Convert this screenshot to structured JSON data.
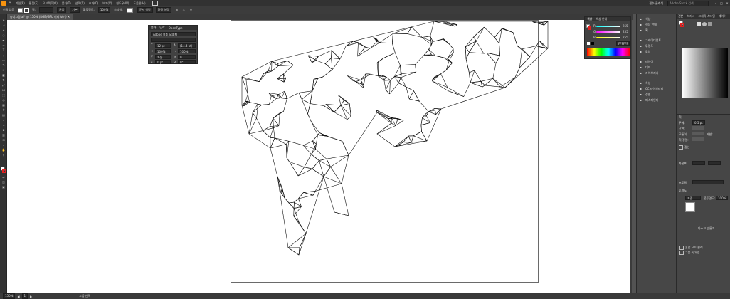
{
  "menu": [
    "파일(F)",
    "편집(E)",
    "오브젝트(O)",
    "문자(T)",
    "선택(S)",
    "효과(C)",
    "보기(V)",
    "윈도우(W)",
    "도움말(H)"
  ],
  "workspace": "필수 클래식",
  "search_placeholder": "Adobe Stock 검색",
  "control": {
    "selection_label": "선택 없음",
    "stroke_label": "획:",
    "stroke_value": "",
    "uniform": "균등",
    "basic": "기본",
    "opacity_label": "불투명도:",
    "opacity_value": "100%",
    "style_label": "스타일:",
    "doc_setup": "문서 설정",
    "prefs": "환경 설정"
  },
  "document_tab": "총기그림.ai* @ 150% (RGB/GPU 미리 보기)",
  "status": {
    "zoom": "150%",
    "page": "1",
    "tool": "그룹 선택"
  },
  "char_panel": {
    "tabs": [
      "문자",
      "단락",
      "OpenType"
    ],
    "font": "Adobe 명조 Std M",
    "font_style": "",
    "size": "12 pt",
    "leading": "(14.4 pt)",
    "kerning": "자동",
    "tracking": "0",
    "scale_v": "100%",
    "scale_h": "100%",
    "baseline": "0 pt",
    "rotate": "0°"
  },
  "color_panel": {
    "tabs": [
      "색상",
      "색상 안내"
    ],
    "channels": [
      {
        "name": "R",
        "value": "255"
      },
      {
        "name": "G",
        "value": "255"
      },
      {
        "name": "B",
        "value": "255"
      }
    ],
    "hex": "FFFFFF"
  },
  "right_panel": {
    "items": [
      {
        "icon": "swatch-icon",
        "label": "색상"
      },
      {
        "icon": "color-guide-icon",
        "label": "색상 안내"
      },
      {
        "icon": "stroke-icon",
        "label": "획"
      },
      {
        "icon": "gradient-icon",
        "label": "그레이디언트"
      },
      {
        "icon": "transparency-icon",
        "label": "투명도"
      },
      {
        "icon": "appearance-icon",
        "label": "모양"
      },
      {
        "icon": "layers-icon",
        "label": "레이어"
      },
      {
        "icon": "artboards-icon",
        "label": "대지"
      },
      {
        "icon": "libraries-icon",
        "label": "라이브러리"
      },
      {
        "icon": "properties-icon",
        "label": "속성"
      },
      {
        "icon": "cc-icon",
        "label": "CC 라이브러리"
      },
      {
        "icon": "align-icon",
        "label": "정렬"
      },
      {
        "icon": "pathfinder-icon",
        "label": "패스파인더"
      }
    ]
  },
  "far_right": {
    "tabs": [
      "견본",
      "브러시",
      "그래픽 스타일",
      "레이어"
    ],
    "stroke_section": "획",
    "weight_label": "두께:",
    "weight_value": "0.5 pt",
    "cap_label": "단면:",
    "corner_label": "모퉁이:",
    "limit_label": "제한:",
    "align_label": "획 정렬:",
    "dashed_label": "점선",
    "arrow_label": "화살표:",
    "profile_label": "프로필:",
    "transparency_section": "투명도",
    "blend_mode": "표준",
    "opacity_label": "불투명도:",
    "opacity_value": "100%",
    "make_mask": "마스크 만들기",
    "clip": "클립",
    "invert": "마스크 반전",
    "isolate": "혼합 모드 분리",
    "knockout": "그룹 녹아웃"
  }
}
